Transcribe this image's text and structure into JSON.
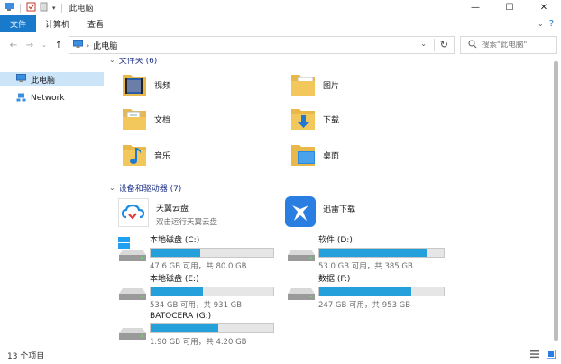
{
  "window": {
    "title": "此电脑"
  },
  "ribbon": {
    "tabs": [
      "文件",
      "计算机",
      "查看"
    ]
  },
  "address": {
    "crumb": "此电脑",
    "search_placeholder": "搜索\"此电脑\""
  },
  "nav": {
    "items": [
      {
        "label": "此电脑",
        "icon": "computer-icon",
        "selected": true
      },
      {
        "label": "Network",
        "icon": "network-icon",
        "selected": false
      }
    ]
  },
  "folders_group": {
    "header": "文件夹 (6)",
    "items": [
      {
        "label": "视频",
        "icon": "video-folder-icon"
      },
      {
        "label": "图片",
        "icon": "pictures-folder-icon"
      },
      {
        "label": "文档",
        "icon": "documents-folder-icon"
      },
      {
        "label": "下载",
        "icon": "downloads-folder-icon"
      },
      {
        "label": "音乐",
        "icon": "music-folder-icon"
      },
      {
        "label": "桌面",
        "icon": "desktop-folder-icon"
      }
    ]
  },
  "devices_group": {
    "header": "设备和驱动器 (7)",
    "apps": [
      {
        "label": "天翼云盘",
        "sub": "双击运行天翼云盘",
        "icon": "tianyi-cloud-icon"
      },
      {
        "label": "迅雷下载",
        "sub": "",
        "icon": "xunlei-icon"
      }
    ],
    "drives": [
      {
        "name": "本地磁盘 (C:)",
        "free": "47.6 GB 可用，共 80.0 GB",
        "used_fraction": 0.405,
        "icon": "windows-drive-icon"
      },
      {
        "name": "软件 (D:)",
        "free": "53.0 GB 可用，共 385 GB",
        "used_fraction": 0.862,
        "icon": "drive-icon"
      },
      {
        "name": "本地磁盘 (E:)",
        "free": "534 GB 可用，共 931 GB",
        "used_fraction": 0.426,
        "icon": "drive-icon"
      },
      {
        "name": "数据 (F:)",
        "free": "247 GB 可用，共 953 GB",
        "used_fraction": 0.741,
        "icon": "drive-icon"
      },
      {
        "name": "BATOCERA (G:)",
        "free": "1.90 GB 可用，共 4.20 GB",
        "used_fraction": 0.548,
        "icon": "drive-icon"
      }
    ]
  },
  "status": {
    "item_count": "13 个项目"
  },
  "colors": {
    "accent": "#1979ca",
    "bar_fill": "#26a0da",
    "group_header": "#1e3287",
    "selection": "#cce4f7"
  }
}
